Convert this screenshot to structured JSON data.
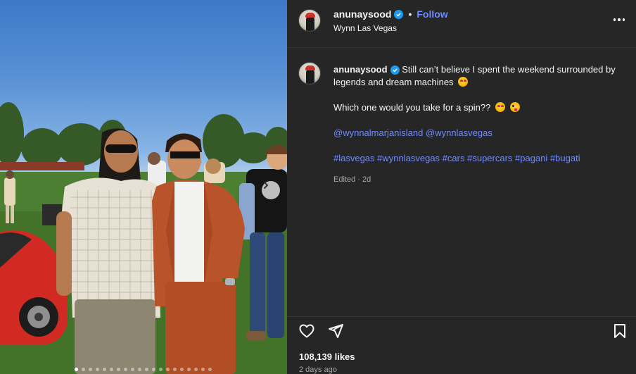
{
  "post": {
    "username": "anunaysood",
    "follow_label": "Follow",
    "separator": "•",
    "location": "Wynn Las Vegas",
    "more_icon": "more-horizontal-icon"
  },
  "caption": {
    "username": "anunaysood",
    "line1": "Still can’t believe I spent the weekend surrounded by legends and dream machines",
    "line2": "Which one would you take for a spin??",
    "mentions": [
      "@wynnalmarjanisland",
      "@wynnlasvegas"
    ],
    "hashtags": [
      "#lasvegas",
      "#wynnlasvegas",
      "#cars",
      "#supercars",
      "#pagani",
      "#bugati"
    ],
    "edited": "Edited · 2d"
  },
  "engagement": {
    "likes": "108,139 likes",
    "time": "2 days ago"
  },
  "carousel": {
    "total_slides": 20,
    "active_index": 0,
    "next_icon": "chevron-right-icon"
  },
  "colors": {
    "panel_bg": "#262626",
    "link": "#6f8cff",
    "verified": "#1d9bf0",
    "muted": "#a8a8a8"
  }
}
